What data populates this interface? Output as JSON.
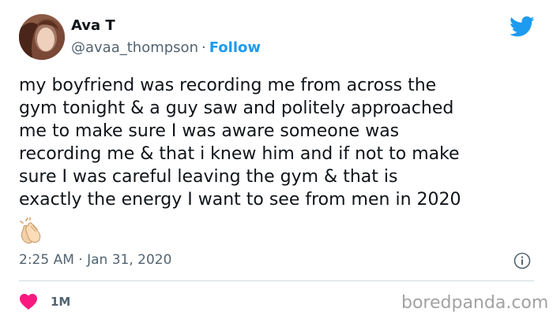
{
  "author": {
    "name": "Ava T",
    "handle": "@avaa_thompson",
    "separator": "·",
    "follow_label": "Follow"
  },
  "tweet": {
    "lines": [
      "my boyfriend was recording me from across the",
      "gym tonight & a guy saw and politely approached",
      "me to make sure I was aware someone was",
      "recording me & that i knew him and if not to make",
      "sure I was careful leaving the gym & that is",
      "exactly the energy I want to see from men in 2020"
    ],
    "emoji_icon": "clapping-hands-icon",
    "timestamp": "2:25 AM · Jan 31, 2020"
  },
  "engagement": {
    "like_count": "1M",
    "like_icon": "heart-icon",
    "like_color": "#f91880"
  },
  "watermark": "boredpanda.com",
  "colors": {
    "twitter_blue": "#1d9bf0",
    "secondary_text": "#536471",
    "divider": "#cfd9de"
  }
}
